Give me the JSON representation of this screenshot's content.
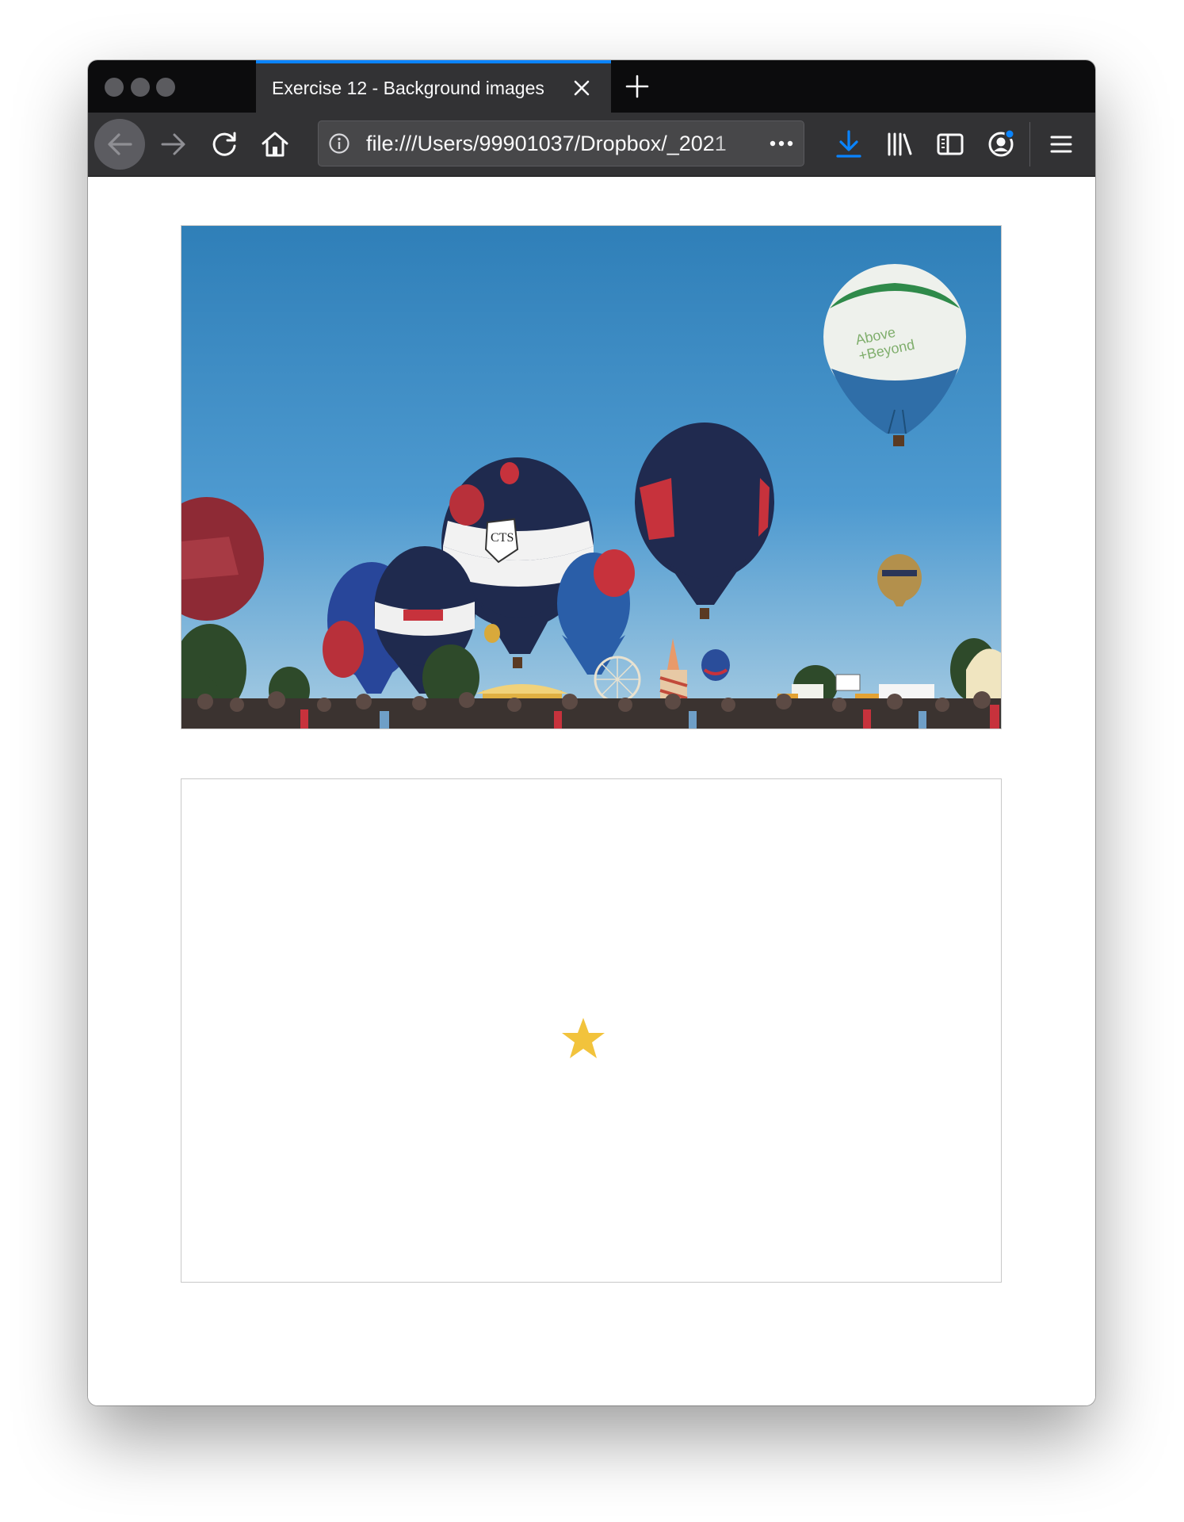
{
  "window": {
    "traffic_lights": [
      "close",
      "minimize",
      "zoom"
    ]
  },
  "tabs": [
    {
      "title": "Exercise 12 - Background images",
      "active": true
    }
  ],
  "toolbar": {
    "url": "file:///Users/99901037/Dropbox/_2021",
    "icons": [
      "back-arrow-icon",
      "forward-arrow-icon",
      "reload-icon",
      "home-icon",
      "info-icon",
      "page-actions-icon",
      "download-icon",
      "library-icon",
      "sidebar-icon",
      "account-icon",
      "menu-icon"
    ]
  },
  "colors": {
    "tab_accent": "#0a84ff",
    "download_icon": "#0a84ff",
    "star": "#f2c33c",
    "sky": "#3a8cc4"
  },
  "content": {
    "photo": {
      "icon": "hot-air-balloons-photo"
    },
    "second_box": {
      "icon": "star-icon"
    }
  }
}
